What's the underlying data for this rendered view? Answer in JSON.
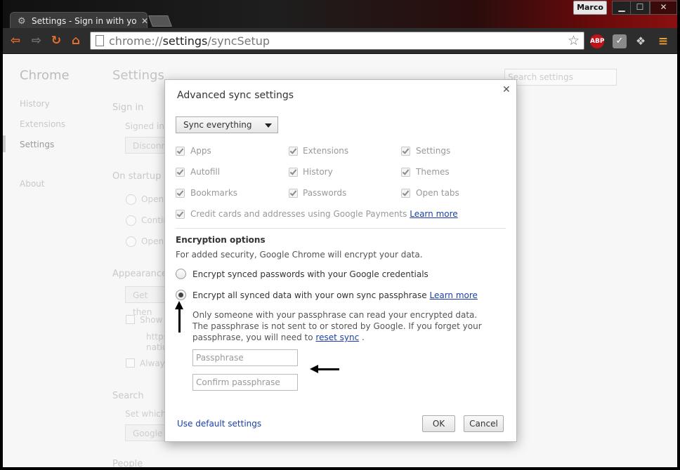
{
  "browser": {
    "tab_title": "Settings - Sign in with you",
    "user_name": "Marco",
    "url_scheme": "chrome://",
    "url_host": "settings",
    "url_path": "/syncSetup",
    "abp_label": "ABP"
  },
  "sidebar": {
    "title": "Chrome",
    "items": [
      {
        "label": "History"
      },
      {
        "label": "Extensions"
      },
      {
        "label": "Settings"
      },
      {
        "label": "About"
      }
    ]
  },
  "settings_bg": {
    "title": "Settings",
    "search_placeholder": "Search settings",
    "sign_in_heading": "Sign in",
    "signed_in_text": "Signed in a",
    "disconnect_label": "Disconne",
    "startup_heading": "On startup",
    "startup_opt1": "Open",
    "startup_opt2": "Contin",
    "startup_opt3": "Open",
    "appearance_heading": "Appearance",
    "get_themes_label": "Get then",
    "show_home_label": "Show",
    "home_url_1": "https",
    "home_url_2": "natio",
    "always_label": "Always",
    "search_heading": "Search",
    "search_text": "Set which s",
    "search_engine": "Google",
    "people_heading": "People"
  },
  "dialog": {
    "title": "Advanced sync settings",
    "close_glyph": "✕",
    "sync_mode": "Sync everything",
    "data_types": [
      {
        "label": "Apps",
        "checked": true
      },
      {
        "label": "Extensions",
        "checked": true
      },
      {
        "label": "Settings",
        "checked": true
      },
      {
        "label": "Autofill",
        "checked": true
      },
      {
        "label": "History",
        "checked": true
      },
      {
        "label": "Themes",
        "checked": true
      },
      {
        "label": "Bookmarks",
        "checked": true
      },
      {
        "label": "Passwords",
        "checked": true
      },
      {
        "label": "Open tabs",
        "checked": true
      }
    ],
    "payments_label": "Credit cards and addresses using Google Payments",
    "learn_more": "Learn more",
    "encryption_heading": "Encryption options",
    "encryption_sub": "For added security, Google Chrome will encrypt your data.",
    "option_google": "Encrypt synced passwords with your Google credentials",
    "option_passphrase": "Encrypt all synced data with your own sync passphrase",
    "explain_text": "Only someone with your passphrase can read your encrypted data. The passphrase is not sent to or stored by Google. If you forget your passphrase, you will need to",
    "reset_sync": "reset sync",
    "explain_end": ".",
    "passphrase_placeholder": "Passphrase",
    "confirm_placeholder": "Confirm passphrase",
    "use_default": "Use default settings",
    "ok_label": "OK",
    "cancel_label": "Cancel"
  }
}
